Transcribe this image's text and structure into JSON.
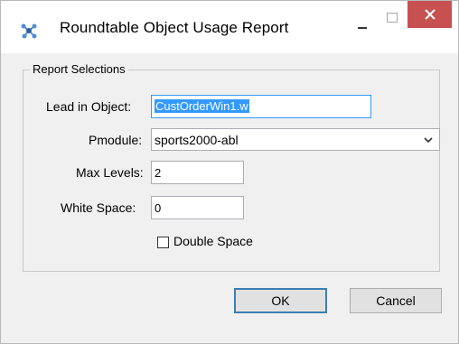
{
  "window": {
    "title": "Roundtable Object Usage Report",
    "controls": {
      "minimize": "minimize",
      "maximize": "maximize",
      "close": "close"
    }
  },
  "group": {
    "legend": "Report Selections"
  },
  "fields": {
    "lead_in_object": {
      "label": "Lead in Object:",
      "value": "CustOrderWin1.w"
    },
    "pmodule": {
      "label": "Pmodule:",
      "value": "sports2000-abl"
    },
    "max_levels": {
      "label": "Max Levels:",
      "value": "2"
    },
    "white_space": {
      "label": "White Space:",
      "value": "0"
    },
    "double_space": {
      "label": "Double Space",
      "checked": false
    }
  },
  "buttons": {
    "ok": "OK",
    "cancel": "Cancel"
  },
  "colors": {
    "close_button": "#c75050",
    "selection": "#3399ff",
    "dialog_bg": "#f0f0f0"
  }
}
